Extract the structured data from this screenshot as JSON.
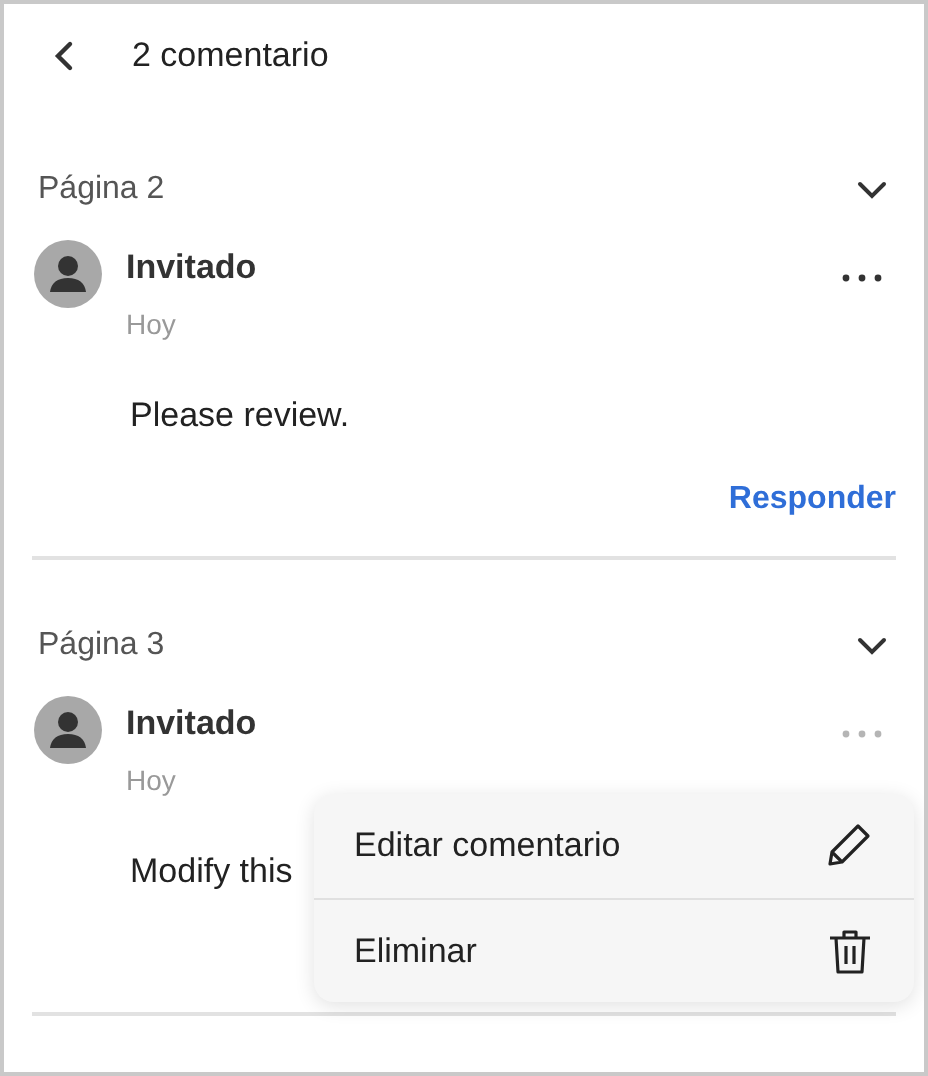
{
  "header": {
    "title": "2 comentario"
  },
  "sections": [
    {
      "title": "Página 2",
      "comments": [
        {
          "author": "Invitado",
          "time": "Hoy",
          "text": "Please review.",
          "reply": "Responder",
          "menu_open": false
        }
      ]
    },
    {
      "title": "Página 3",
      "comments": [
        {
          "author": "Invitado",
          "time": "Hoy",
          "text": "Modify this",
          "menu_open": true
        }
      ]
    }
  ],
  "menu": {
    "items": [
      {
        "kind": "edit",
        "label": "Editar comentario"
      },
      {
        "kind": "delete",
        "label": "Eliminar"
      }
    ]
  }
}
